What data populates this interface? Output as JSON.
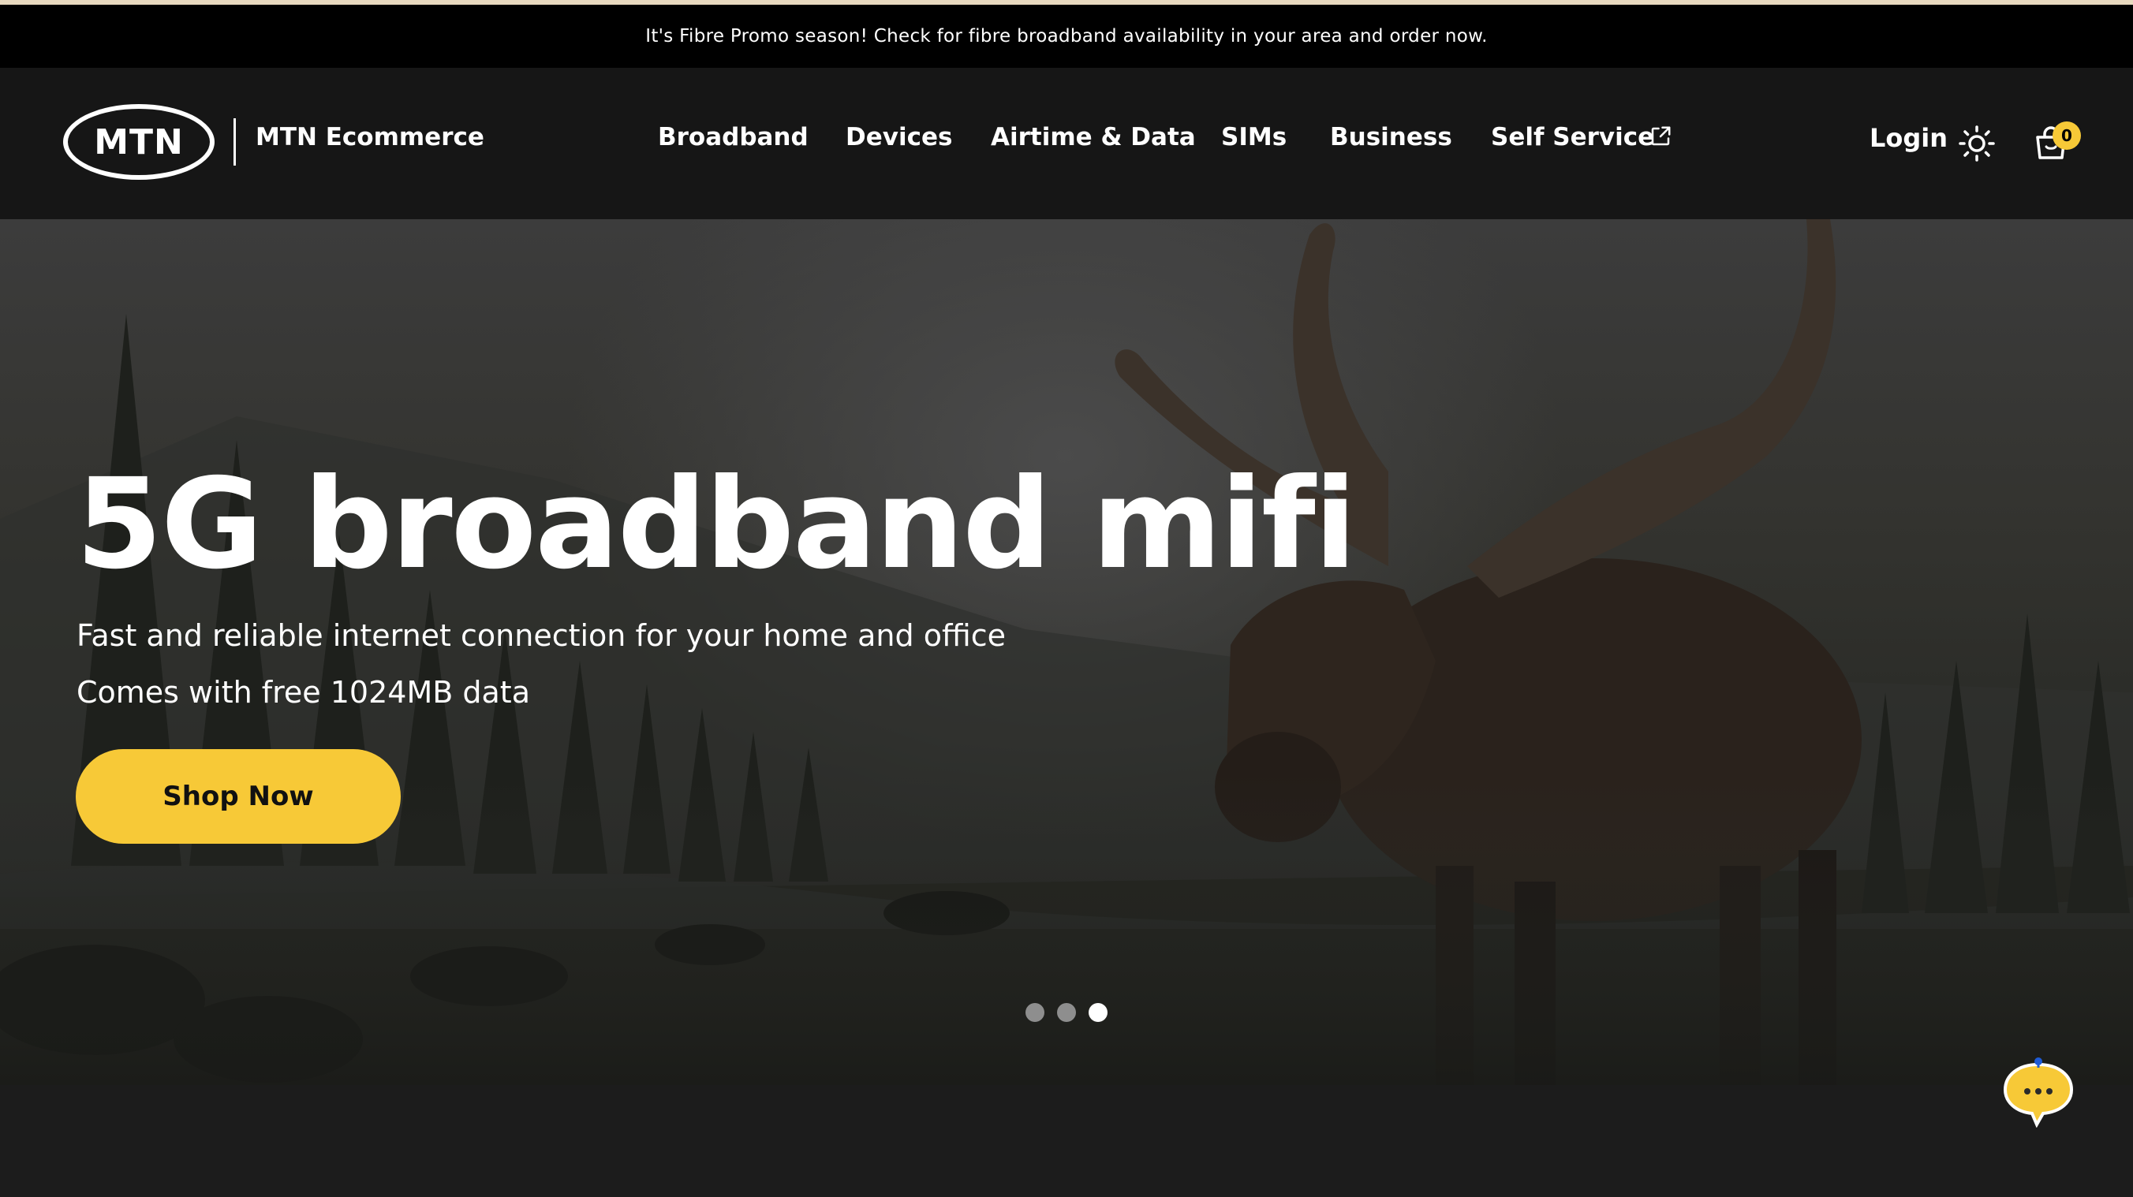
{
  "promo": {
    "text": "It's Fibre Promo season! Check for fibre broadband availability in your area and order now."
  },
  "header": {
    "logo_text": "MTN",
    "site_name": "MTN Ecommerce",
    "nav": [
      {
        "label": "Broadband"
      },
      {
        "label": "Devices"
      },
      {
        "label": "Airtime & Data"
      },
      {
        "label": "SIMs"
      },
      {
        "label": "Business"
      },
      {
        "label": "Self Service",
        "icon": "external-link-icon"
      }
    ],
    "login_label": "Login",
    "theme_icon": "sun-icon",
    "cart": {
      "icon": "shopping-bag-icon",
      "count": "0"
    }
  },
  "hero": {
    "title": "5G broadband mifi",
    "line1": "Fast and reliable internet connection for your home and office",
    "line2": "Comes with free 1024MB data",
    "cta_label": "Shop Now",
    "background_image": "moose standing in misty forest lake at dusk",
    "carousel": {
      "slides": 3,
      "active_index": 2
    }
  },
  "chat": {
    "icon": "chat-bubble-icon"
  },
  "colors": {
    "accent": "#f7c937",
    "header_bg": "#161616",
    "promo_bg": "#000000",
    "page_bg": "#1c1c1c"
  }
}
